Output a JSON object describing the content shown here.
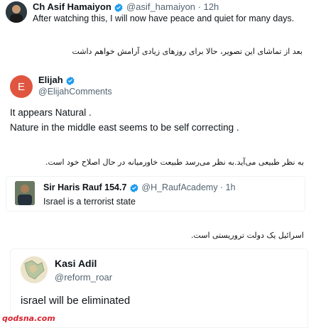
{
  "tweet1": {
    "name": "Ch Asif Hamaiyon",
    "handle_time": "@asif_hamaiyon · 12h",
    "text": "After watching this, I will now have peace and quiet for many days."
  },
  "caption1": "بعد از تماشای این تصویر، حالا برای روزهای زیادی آرامش خواهم داشت",
  "tweet2": {
    "avatar_letter": "E",
    "name": "Elijah",
    "handle": "@ElijahComments",
    "line1": "It appears Natural .",
    "line2": "Nature in the middle east seems to be self correcting ."
  },
  "caption2": "به نظر طبیعی می‌آید.به نظر می‌رسد طبیعت خاورمیانه در حال اصلاح خود است.",
  "tweet3": {
    "name": "Sir Haris Rauf 154.7",
    "handle_time": "@H_RaufAcademy · 1h",
    "text": "Israel is a terrorist state"
  },
  "caption3": "اسرائیل یک دولت تروریستی است.",
  "tweet4": {
    "name": "Kasi Adil",
    "handle": "@reform_roar",
    "text": "israel will be eliminated"
  },
  "watermark": "qodsna.com",
  "colors": {
    "verified": "#1d9bf0",
    "avatar_e": "#e0553f",
    "watermark": "#d9232e"
  }
}
